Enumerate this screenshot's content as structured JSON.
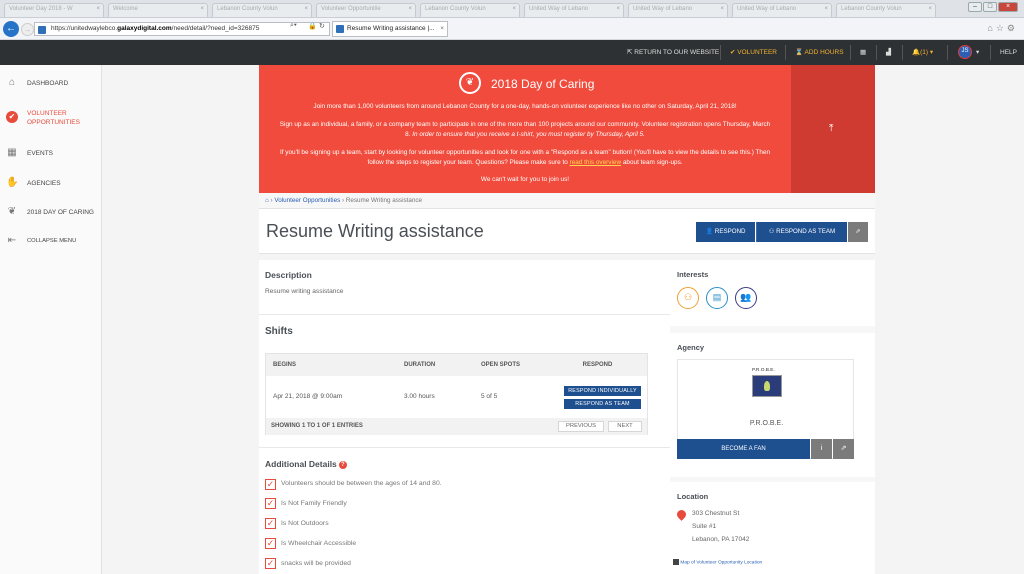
{
  "browser": {
    "tabs": [
      {
        "label": "Volunteer Day 2018 - W"
      },
      {
        "label": "Welcome"
      },
      {
        "label": "Lebanon County Volun"
      },
      {
        "label": "Volunteer Opportunitie"
      },
      {
        "label": "Lebanon County Volun"
      },
      {
        "label": "United Way of Lebano"
      },
      {
        "label": "United Way of Lebano"
      },
      {
        "label": "United Way of Lebano"
      },
      {
        "label": "Lebanon County Volun"
      }
    ],
    "url_prefix": "https://unitedwaylebco.",
    "url_domain": "galaxydigital.com",
    "url_suffix": "/need/detail/?need_id=326875",
    "active_tab": "Resume Writing assistance |..."
  },
  "topnav": {
    "return_label": "RETURN TO OUR WEBSITE",
    "volunteer_label": "VOLUNTEER",
    "add_hours_label": "ADD HOURS",
    "notifications_label": "(1)",
    "avatar_initials": "JS",
    "help_label": "HELP"
  },
  "sidebar": {
    "items": [
      {
        "label": "DASHBOARD"
      },
      {
        "label": "VOLUNTEER OPPORTUNITIES"
      },
      {
        "label": "EVENTS"
      },
      {
        "label": "AGENCIES"
      },
      {
        "label": "2018 DAY OF CARING"
      },
      {
        "label": "COLLAPSE MENU"
      }
    ]
  },
  "banner": {
    "title": "2018 Day of Caring",
    "p1": "Join more than 1,000 volunteers from around Lebanon County for a one-day, hands-on volunteer experience like no other on Saturday, April 21, 2018!",
    "p2a": "Sign up as an individual, a family, or a company team to participate in one of the more than 100 projects around our community. Volunteer registration opens Thursday, March 8.",
    "p2b": "In order to ensure that you receive a t-shirt, you must register by Thursday, April 5.",
    "p3a": "If you'll be signing up a team, start by looking for volunteer opportunities and look for one with a \"Respond as a team\" button! (You'll have to view the details to see this.) Then follow the steps to register your team. Questions? Please make sure to",
    "p3link": "read this overview",
    "p3b": "about team sign-ups.",
    "p4": "We can't wait for you to join us!"
  },
  "breadcrumb": {
    "item1": "Volunteer Opportunities",
    "item2": "Resume Writing assistance"
  },
  "page": {
    "title": "Resume Writing assistance",
    "respond_label": "RESPOND",
    "respond_team_label": "RESPOND AS TEAM"
  },
  "description": {
    "heading": "Description",
    "text": "Resume writing assistance"
  },
  "shifts": {
    "heading": "Shifts",
    "columns": [
      "BEGINS",
      "DURATION",
      "OPEN SPOTS",
      "RESPOND"
    ],
    "rows": [
      {
        "begins": "Apr 21, 2018 @ 9:00am",
        "duration": "3.00 hours",
        "open_spots": "5 of 5"
      }
    ],
    "respond_individually": "RESPOND INDIVIDUALLY",
    "respond_as_team": "RESPOND AS TEAM",
    "showing": "SHOWING 1 TO 1 OF 1 ENTRIES",
    "previous": "PREVIOUS",
    "next": "NEXT"
  },
  "additional": {
    "heading": "Additional Details",
    "items": [
      "Volunteers should be between the ages of 14 and 80.",
      "Is Not Family Friendly",
      "Is Not Outdoors",
      "Is Wheelchair Accessible",
      "snacks will be provided"
    ]
  },
  "interests": {
    "heading": "Interests",
    "icons": [
      "people-icon",
      "clipboard-icon",
      "group-icon"
    ]
  },
  "agency": {
    "heading": "Agency",
    "logo_text": "P.R.O.B.E.",
    "name": "P.R.O.B.E.",
    "fan_label": "BECOME A FAN"
  },
  "location": {
    "heading": "Location",
    "line1": "303 Chestnut St",
    "line2": "Suite #1",
    "line3": "Lebanon, PA 17042",
    "map_label": "Map of Volunteer Opportunity Location"
  },
  "colors": {
    "accent_red": "#f04b3c",
    "primary_blue": "#1e4f8f",
    "topbar": "#2e3133",
    "highlight_yellow": "#f2b233"
  }
}
